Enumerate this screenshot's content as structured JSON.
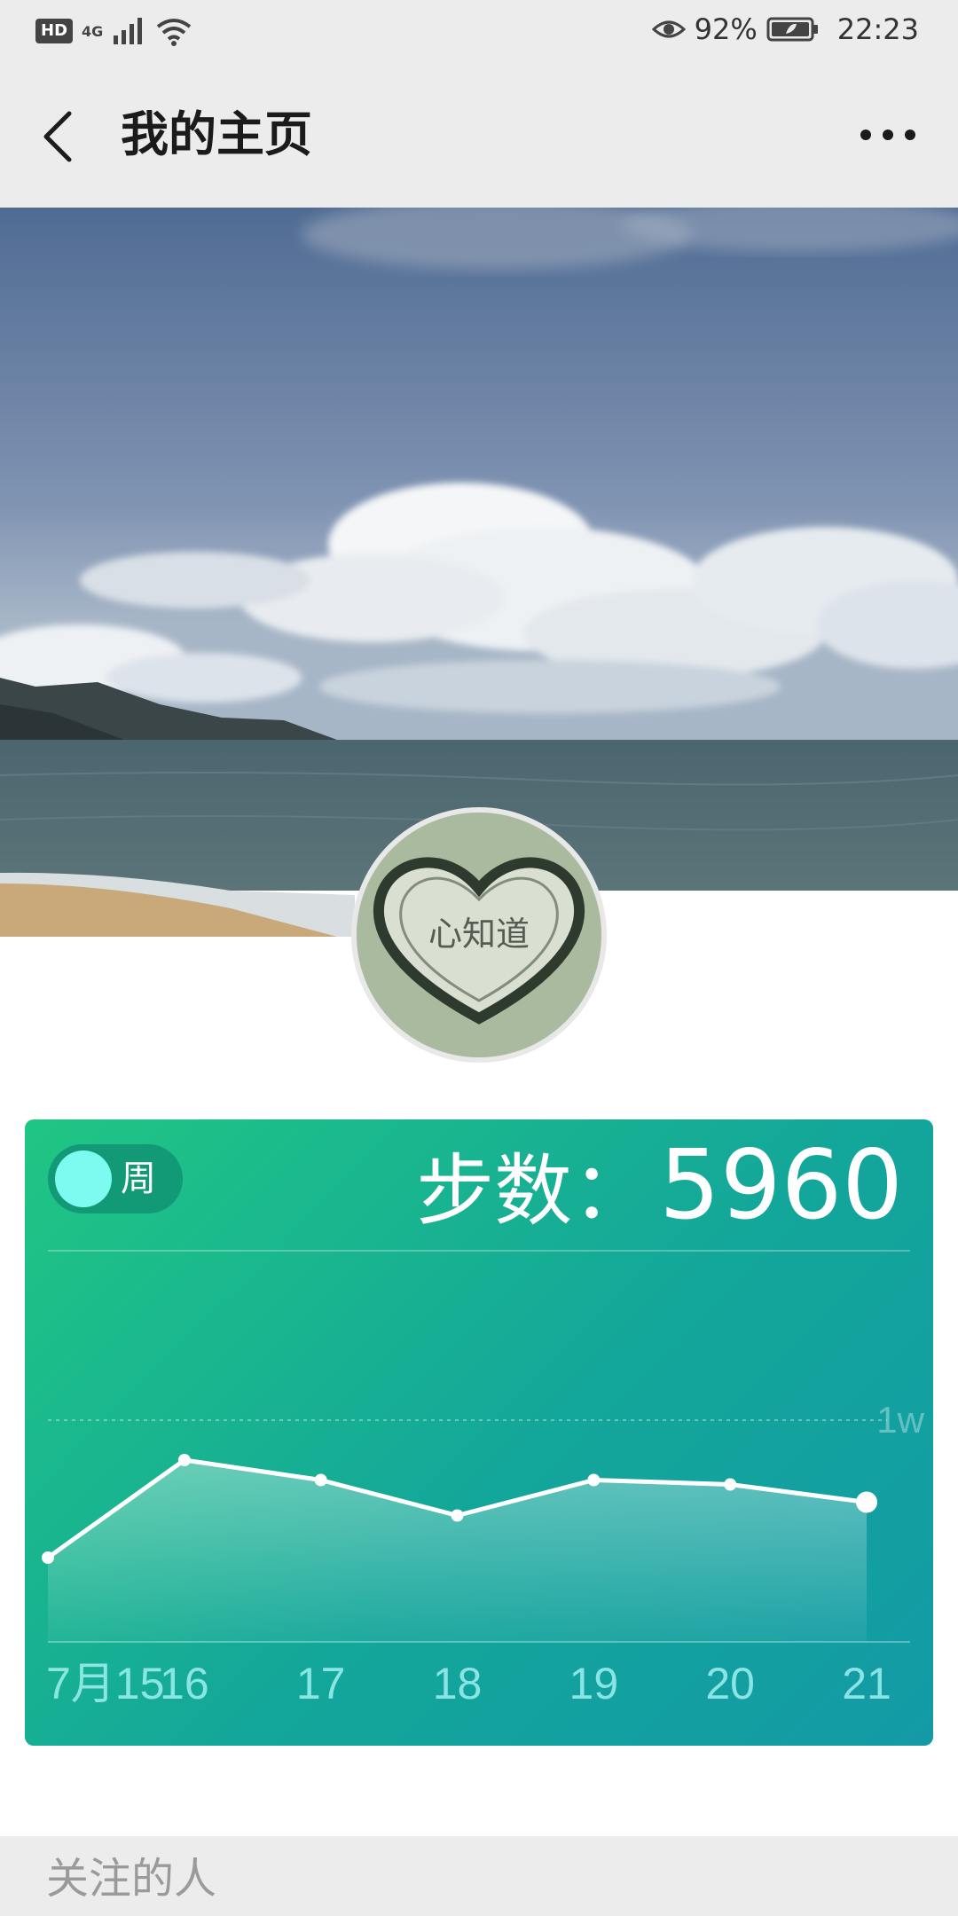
{
  "status_bar": {
    "hd_badge": "HD",
    "network": "4G",
    "battery_percent": "92%",
    "time": "22:23",
    "icons": [
      "hd-icon",
      "signal-icon",
      "wifi-icon",
      "eye-icon",
      "battery-icon"
    ]
  },
  "header": {
    "title": "我的主页",
    "back_icon": "chevron-left-icon",
    "more_icon": "more-dots-icon"
  },
  "avatar": {
    "image_text": "心知道"
  },
  "steps_card": {
    "toggle_label": "周",
    "steps_label": "步数：",
    "steps_value": "5960",
    "colors": {
      "gradient_start": "#20c683",
      "gradient_end": "#139aa6",
      "toggle_knob": "#7dfbf0"
    }
  },
  "chart_data": {
    "type": "area",
    "categories": [
      "7月15",
      "16",
      "17",
      "18",
      "19",
      "20",
      "21"
    ],
    "values": [
      3800,
      8200,
      7300,
      5700,
      7300,
      7100,
      6300
    ],
    "reference_line": {
      "value": 10000,
      "label": "1w"
    },
    "ylim": [
      0,
      10000
    ],
    "title": "",
    "xlabel": "",
    "ylabel": "",
    "grid": false
  },
  "following": {
    "label": "关注的人"
  }
}
